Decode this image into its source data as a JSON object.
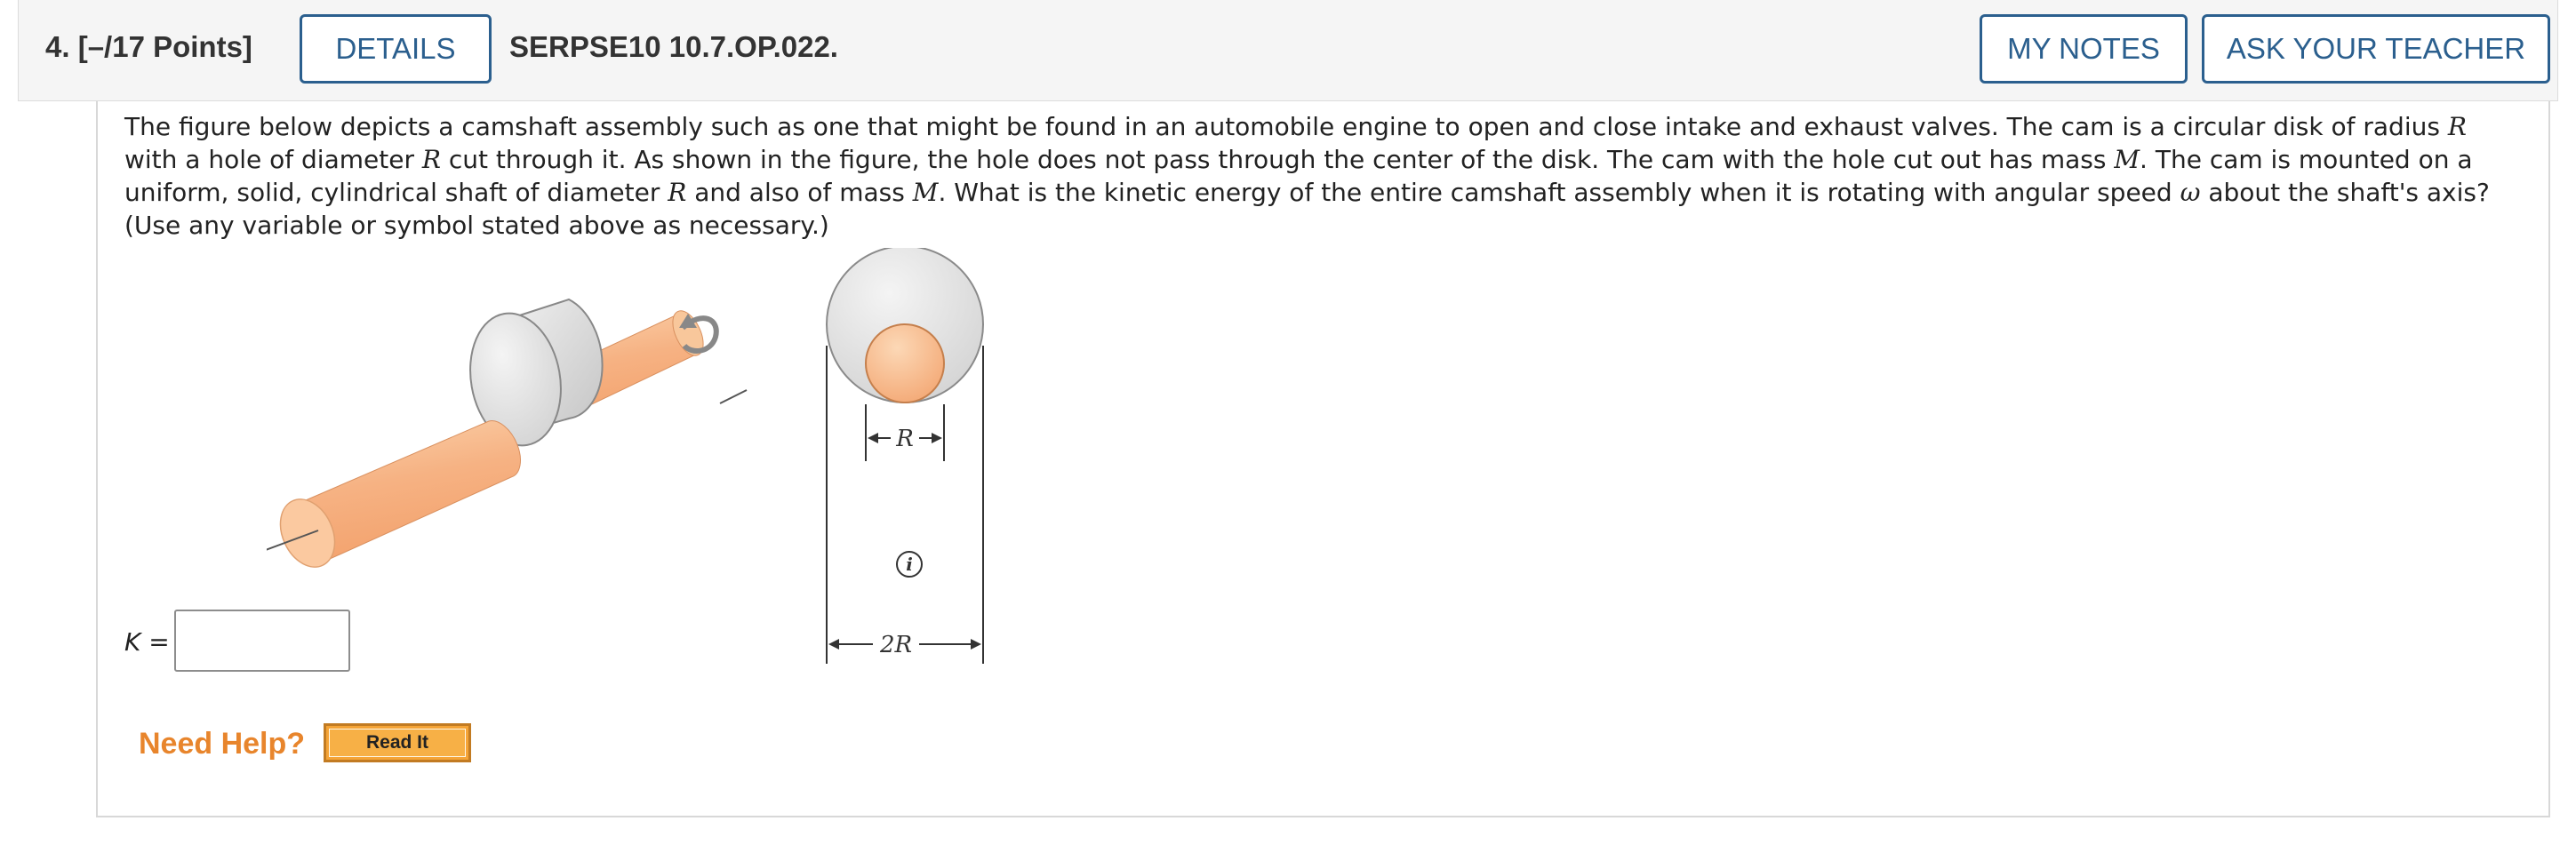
{
  "header": {
    "question_number": "4.",
    "points": "[–/17 Points]",
    "details_label": "DETAILS",
    "problem_code": "SERPSE10 10.7.OP.022.",
    "my_notes_label": "MY NOTES",
    "ask_teacher_label": "ASK YOUR TEACHER"
  },
  "question": {
    "text_parts": [
      "The figure below depicts a camshaft assembly such as one that might be found in an automobile engine to open and close intake and exhaust valves. The cam is a circular disk of radius ",
      "R",
      " with a hole of diameter ",
      "R",
      " cut through it. As shown in the figure, the hole does not pass through the center of the disk. The cam with the hole cut out has mass ",
      "M",
      ". The cam is mounted on a uniform, solid, cylindrical shaft of diameter ",
      "R",
      " and also of mass ",
      "M",
      ". What is the kinetic energy of the entire camshaft assembly when it is rotating with angular speed ",
      "ω",
      " about the shaft's axis? (Use any variable or symbol stated above as necessary.)"
    ]
  },
  "figure": {
    "label_r": "R",
    "label_2r": "2R",
    "info_icon": "i"
  },
  "answer": {
    "variable": "K",
    "equals": " =",
    "value": ""
  },
  "help": {
    "need_help_label": "Need Help?",
    "read_it_label": "Read It"
  },
  "colors": {
    "button_blue": "#2b5f8e",
    "need_help_orange": "#e8852c",
    "read_it_fill": "#f5a437",
    "shaft_orange": "#f6b98a",
    "cam_gray": "#d4d4d4"
  }
}
